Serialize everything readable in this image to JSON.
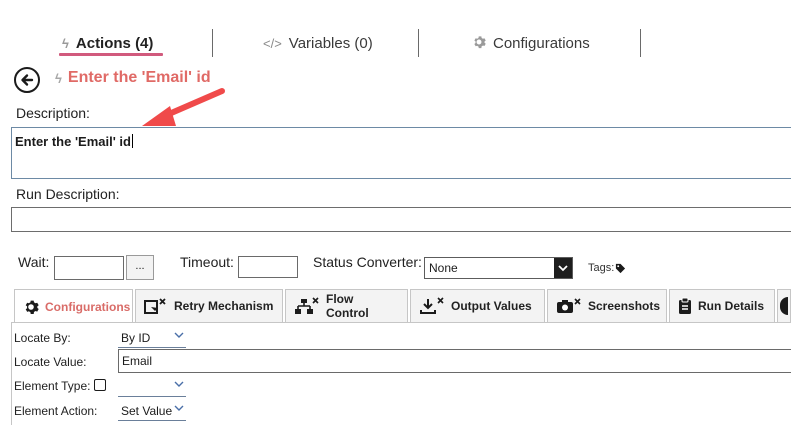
{
  "top_tabs": {
    "actions": "Actions (4)",
    "variables": "Variables (0)",
    "configurations": "Configurations"
  },
  "header": {
    "title": "Enter the 'Email' id"
  },
  "description": {
    "label": "Description:",
    "value": "Enter the 'Email' id"
  },
  "run_description": {
    "label": "Run Description:",
    "value": ""
  },
  "wait_row": {
    "wait_label": "Wait:",
    "dots_label": "...",
    "timeout_label": "Timeout:",
    "status_label": "Status Converter:",
    "status_value": "None",
    "tags_label": "Tags:"
  },
  "lower_tabs": [
    {
      "label": "Configurations"
    },
    {
      "label": "Retry Mechanism"
    },
    {
      "label": "Flow Control"
    },
    {
      "label": "Output Values"
    },
    {
      "label": "Screenshots"
    },
    {
      "label": "Run Details"
    }
  ],
  "fields": {
    "locate_by_label": "Locate By:",
    "locate_by_value": "By ID",
    "locate_value_label": "Locate Value:",
    "locate_value": "Email",
    "element_type_label": "Element Type:",
    "element_type_value": "",
    "element_action_label": "Element Action:",
    "element_action_value": "Set Value"
  },
  "colors": {
    "accent_red": "#e06a66",
    "tab_underline": "#d15a7d",
    "arrow": "#f04a4a"
  }
}
